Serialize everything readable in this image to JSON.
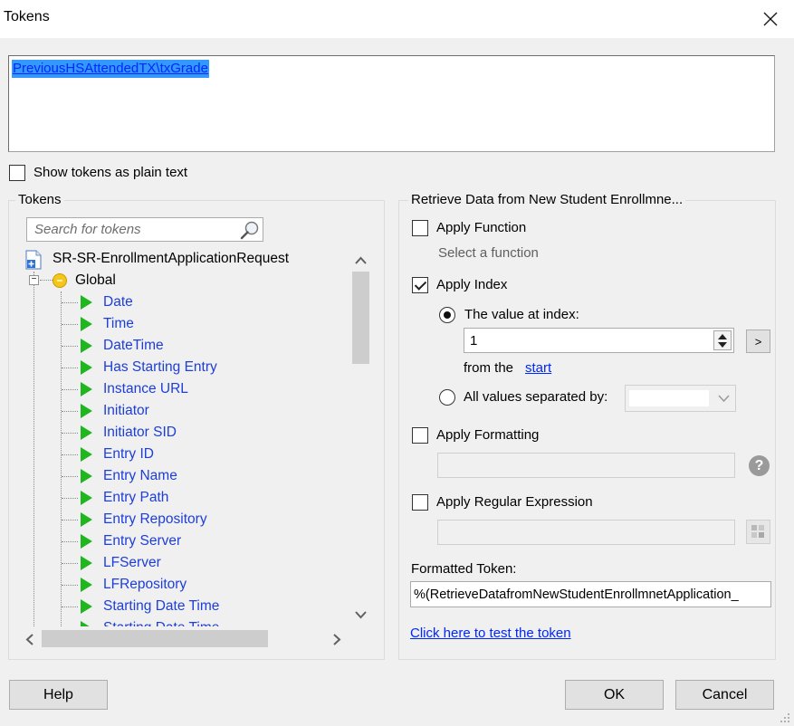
{
  "window": {
    "title": "Tokens"
  },
  "token_editor": {
    "value": "PreviousHSAttendedTX\\txGrade"
  },
  "plain_text_option": {
    "label": "Show tokens as plain text",
    "checked": false
  },
  "tokens_panel": {
    "legend": "Tokens",
    "search_placeholder": "Search for tokens",
    "root": "SR-SR-EnrollmentApplicationRequest",
    "global": "Global",
    "items": [
      "Date",
      "Time",
      "DateTime",
      "Has Starting Entry",
      "Instance URL",
      "Initiator",
      "Initiator SID",
      "Entry ID",
      "Entry Name",
      "Entry Path",
      "Entry Repository",
      "Entry Server",
      "LFServer",
      "LFRepository",
      "Starting Date Time",
      "Starting Date Time"
    ]
  },
  "retrieve_panel": {
    "legend": "Retrieve Data from New Student Enrollmne...",
    "apply_function": {
      "label": "Apply Function",
      "checked": false,
      "sub": "Select a function"
    },
    "apply_index": {
      "label": "Apply Index",
      "checked": true,
      "value_at_index": {
        "label": "The value at index:",
        "selected": true,
        "value": "1"
      },
      "from_the": "from the",
      "start_link": "start",
      "all_values": {
        "label": "All values separated by:",
        "selected": false
      },
      "next_label": ">"
    },
    "apply_formatting": {
      "label": "Apply Formatting",
      "checked": false,
      "help": "?"
    },
    "apply_regex": {
      "label": "Apply Regular Expression",
      "checked": false
    },
    "formatted_token": {
      "label": "Formatted Token:",
      "value": "%(RetrieveDatafromNewStudentEnrollmnetApplication_"
    },
    "test_link": "Click here to test the token"
  },
  "buttons": {
    "help": "Help",
    "ok": "OK",
    "cancel": "Cancel"
  }
}
